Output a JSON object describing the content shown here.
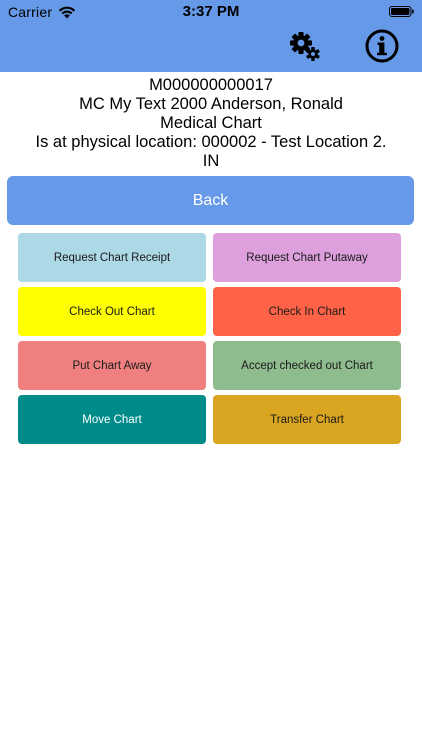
{
  "status_bar": {
    "carrier": "Carrier",
    "time": "3:37 PM"
  },
  "nav": {
    "icons": [
      "gear-icon",
      "info-icon"
    ],
    "color": "#6699e8"
  },
  "patient": {
    "chart_id": "M000000000017",
    "name_line": "MC My Text 2000 Anderson, Ronald",
    "chart_type": "Medical Chart",
    "location_line": "Is at physical location: 000002 - Test Location 2.",
    "status": "IN"
  },
  "back_button": {
    "label": "Back",
    "color": "#6699e8"
  },
  "actions": [
    {
      "label": "Request Chart Receipt",
      "color": "#add8e6",
      "text_color": "#1a1a1a"
    },
    {
      "label": "Request Chart Putaway",
      "color": "#dda0dd",
      "text_color": "#1a1a1a"
    },
    {
      "label": "Check Out Chart",
      "color": "#ffff00",
      "text_color": "#1a1a1a"
    },
    {
      "label": "Check In Chart",
      "color": "#ff6347",
      "text_color": "#1a1a1a"
    },
    {
      "label": "Put Chart Away",
      "color": "#f08080",
      "text_color": "#1a1a1a"
    },
    {
      "label": "Accept checked out Chart",
      "color": "#8fbc8f",
      "text_color": "#1a1a1a"
    },
    {
      "label": "Move Chart",
      "color": "#008b8b",
      "text_color": "#ffffff"
    },
    {
      "label": "Transfer Chart",
      "color": "#daa520",
      "text_color": "#1a1a1a"
    }
  ]
}
